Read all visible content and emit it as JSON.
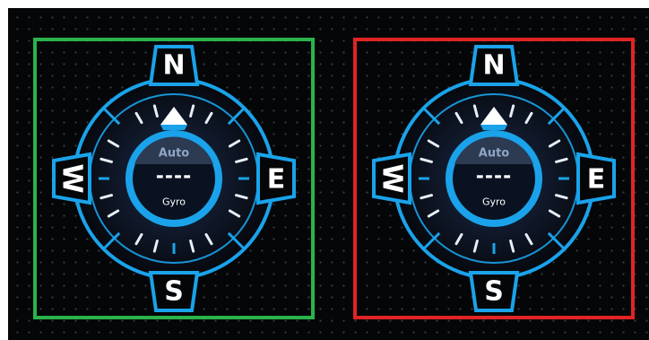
{
  "colors": {
    "background": "#050608",
    "accent": "#1aa3ea",
    "panel_left_border": "#2ab34a",
    "panel_right_border": "#e02424"
  },
  "compasses": [
    {
      "directions": {
        "north": "N",
        "east": "E",
        "south": "S",
        "west": "W"
      },
      "mode_label": "Auto",
      "heading_value": "----",
      "sensor_label": "Gyro",
      "icons": {
        "pointer": "north-pointer-icon"
      }
    },
    {
      "directions": {
        "north": "N",
        "east": "E",
        "south": "S",
        "west": "W"
      },
      "mode_label": "Auto",
      "heading_value": "----",
      "sensor_label": "Gyro",
      "icons": {
        "pointer": "north-pointer-icon"
      }
    }
  ]
}
